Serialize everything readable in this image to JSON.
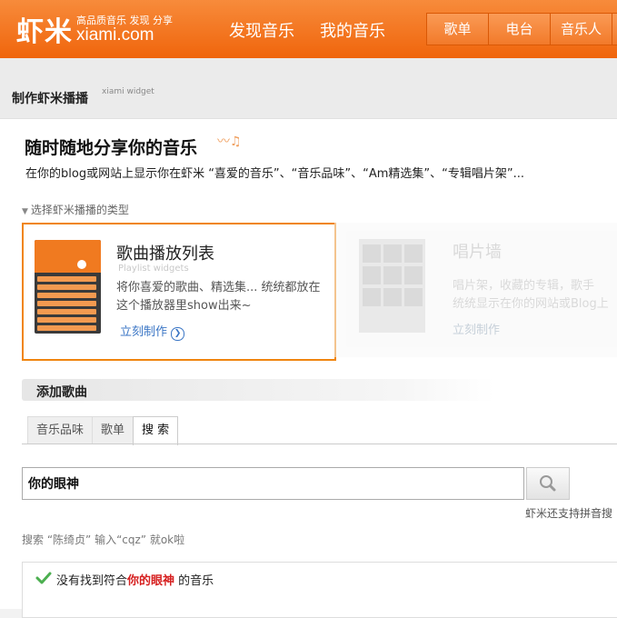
{
  "header": {
    "logo_text": "虾米",
    "logo_slogan": "高品质音乐 发现 分享",
    "logo_domain": "xiami.com",
    "nav_main": [
      "发现音乐",
      "我的音乐"
    ],
    "nav_box": [
      "歌单",
      "电台",
      "音乐人"
    ],
    "accent_color": "#f0650c"
  },
  "page": {
    "title": "制作虾米播播",
    "title_en": "xiami widget"
  },
  "hero": {
    "title": "随时随地分享你的音乐",
    "description": "在你的blog或网站上显示你在虾米 “喜爱的音乐”、“音乐品味”、“Am精选集”、“专辑唱片架”..."
  },
  "widget_type": {
    "label": "选择虾米播播的类型",
    "cards": [
      {
        "title": "歌曲播放列表",
        "subtitle": "Playlist widgets",
        "description": "将你喜爱的歌曲、精选集... 统统都放在这个播放器里show出来~",
        "link": "立刻制作",
        "selected": true,
        "thumb_icon": "playlist-widget-thumbnail"
      },
      {
        "title": "唱片墙",
        "description_line1": "唱片架，收藏的专辑，歌手",
        "description_line2": "统统显示在你的网站或Blog上",
        "link": "立刻制作",
        "selected": false,
        "thumb_icon": "album-wall-thumbnail"
      }
    ]
  },
  "add_songs": {
    "title": "添加歌曲",
    "tabs": [
      "音乐品味",
      "歌单",
      "搜 索"
    ],
    "active_tab": 2,
    "search_value": "你的眼神",
    "search_icon": "magnifier-icon",
    "pinyin_note": "虾米还支持拼音搜",
    "hint": "搜索 “陈绮贞” 输入“cqz” 就ok啦",
    "result": {
      "prefix": "没有找到符合",
      "keyword": "你的眼神",
      "suffix": " 的音乐",
      "icon": "check-icon"
    }
  }
}
